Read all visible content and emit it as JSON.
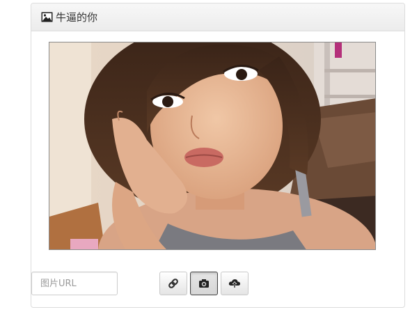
{
  "panel": {
    "title": "牛逼的你",
    "title_icon": "picture-icon"
  },
  "photo": {
    "description_icon": "portrait-photo"
  },
  "toolbar": {
    "url_placeholder": "图片URL",
    "url_value": "",
    "buttons": [
      {
        "icon": "link-icon",
        "active": false
      },
      {
        "icon": "camera-icon",
        "active": true
      },
      {
        "icon": "upload-cloud-icon",
        "active": false
      }
    ]
  },
  "colors": {
    "panel_border": "#dcdcdc",
    "heading_bg": "#f2f2f2",
    "active_border": "#444444"
  }
}
